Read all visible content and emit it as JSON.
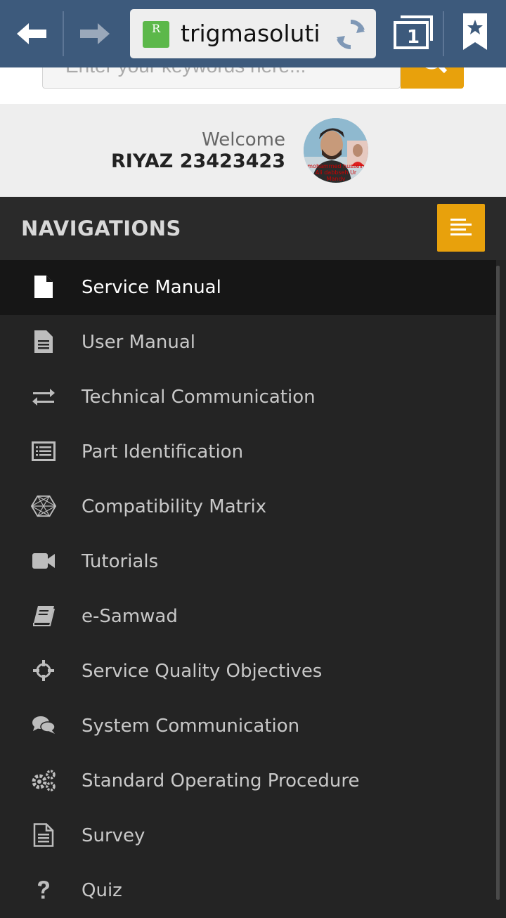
{
  "browser": {
    "url": "trigmasolutic",
    "tab_count": "1",
    "site_icon_letter": "R"
  },
  "search": {
    "placeholder": "Enter your keywords here..."
  },
  "welcome": {
    "label": "Welcome",
    "user": "RIYAZ 23423423",
    "avatar_caption": "mohammed hussein Ali dabbseh Ur Mandv"
  },
  "nav": {
    "title": "NAVIGATIONS",
    "items": [
      {
        "label": "Service Manual",
        "icon": "file-icon",
        "active": true
      },
      {
        "label": "User Manual",
        "icon": "document-text-icon"
      },
      {
        "label": "Technical Communication",
        "icon": "exchange-arrows-icon"
      },
      {
        "label": "Part Identification",
        "icon": "list-box-icon"
      },
      {
        "label": "Compatibility Matrix",
        "icon": "hexagon-mesh-icon"
      },
      {
        "label": "Tutorials",
        "icon": "video-camera-icon"
      },
      {
        "label": "e-Samwad",
        "icon": "book-icon"
      },
      {
        "label": "Service Quality Objectives",
        "icon": "crosshair-icon"
      },
      {
        "label": "System Communication",
        "icon": "chat-bubbles-icon"
      },
      {
        "label": "Standard Operating Procedure",
        "icon": "gears-icon"
      },
      {
        "label": "Survey",
        "icon": "document-outline-icon"
      },
      {
        "label": "Quiz",
        "icon": "question-icon"
      }
    ]
  },
  "colors": {
    "toolbar": "#3d5a7c",
    "accent": "#e8a10c",
    "nav_bg": "#242424",
    "active_item": "#161616"
  }
}
